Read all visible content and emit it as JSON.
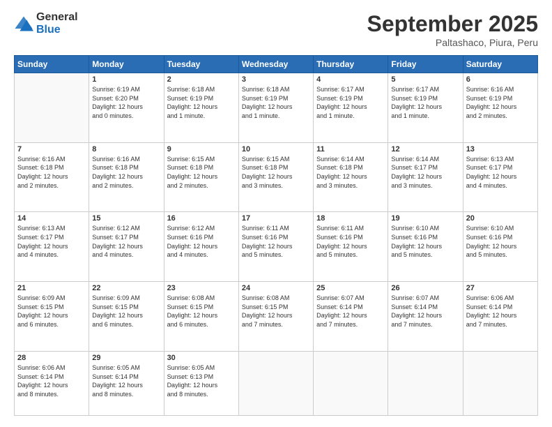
{
  "logo": {
    "general": "General",
    "blue": "Blue"
  },
  "header": {
    "title": "September 2025",
    "subtitle": "Paltashaco, Piura, Peru"
  },
  "days_of_week": [
    "Sunday",
    "Monday",
    "Tuesday",
    "Wednesday",
    "Thursday",
    "Friday",
    "Saturday"
  ],
  "weeks": [
    [
      {
        "day": "",
        "info": ""
      },
      {
        "day": "1",
        "info": "Sunrise: 6:19 AM\nSunset: 6:20 PM\nDaylight: 12 hours\nand 0 minutes."
      },
      {
        "day": "2",
        "info": "Sunrise: 6:18 AM\nSunset: 6:19 PM\nDaylight: 12 hours\nand 1 minute."
      },
      {
        "day": "3",
        "info": "Sunrise: 6:18 AM\nSunset: 6:19 PM\nDaylight: 12 hours\nand 1 minute."
      },
      {
        "day": "4",
        "info": "Sunrise: 6:17 AM\nSunset: 6:19 PM\nDaylight: 12 hours\nand 1 minute."
      },
      {
        "day": "5",
        "info": "Sunrise: 6:17 AM\nSunset: 6:19 PM\nDaylight: 12 hours\nand 1 minute."
      },
      {
        "day": "6",
        "info": "Sunrise: 6:16 AM\nSunset: 6:19 PM\nDaylight: 12 hours\nand 2 minutes."
      }
    ],
    [
      {
        "day": "7",
        "info": "Sunrise: 6:16 AM\nSunset: 6:18 PM\nDaylight: 12 hours\nand 2 minutes."
      },
      {
        "day": "8",
        "info": "Sunrise: 6:16 AM\nSunset: 6:18 PM\nDaylight: 12 hours\nand 2 minutes."
      },
      {
        "day": "9",
        "info": "Sunrise: 6:15 AM\nSunset: 6:18 PM\nDaylight: 12 hours\nand 2 minutes."
      },
      {
        "day": "10",
        "info": "Sunrise: 6:15 AM\nSunset: 6:18 PM\nDaylight: 12 hours\nand 3 minutes."
      },
      {
        "day": "11",
        "info": "Sunrise: 6:14 AM\nSunset: 6:18 PM\nDaylight: 12 hours\nand 3 minutes."
      },
      {
        "day": "12",
        "info": "Sunrise: 6:14 AM\nSunset: 6:17 PM\nDaylight: 12 hours\nand 3 minutes."
      },
      {
        "day": "13",
        "info": "Sunrise: 6:13 AM\nSunset: 6:17 PM\nDaylight: 12 hours\nand 4 minutes."
      }
    ],
    [
      {
        "day": "14",
        "info": "Sunrise: 6:13 AM\nSunset: 6:17 PM\nDaylight: 12 hours\nand 4 minutes."
      },
      {
        "day": "15",
        "info": "Sunrise: 6:12 AM\nSunset: 6:17 PM\nDaylight: 12 hours\nand 4 minutes."
      },
      {
        "day": "16",
        "info": "Sunrise: 6:12 AM\nSunset: 6:16 PM\nDaylight: 12 hours\nand 4 minutes."
      },
      {
        "day": "17",
        "info": "Sunrise: 6:11 AM\nSunset: 6:16 PM\nDaylight: 12 hours\nand 5 minutes."
      },
      {
        "day": "18",
        "info": "Sunrise: 6:11 AM\nSunset: 6:16 PM\nDaylight: 12 hours\nand 5 minutes."
      },
      {
        "day": "19",
        "info": "Sunrise: 6:10 AM\nSunset: 6:16 PM\nDaylight: 12 hours\nand 5 minutes."
      },
      {
        "day": "20",
        "info": "Sunrise: 6:10 AM\nSunset: 6:16 PM\nDaylight: 12 hours\nand 5 minutes."
      }
    ],
    [
      {
        "day": "21",
        "info": "Sunrise: 6:09 AM\nSunset: 6:15 PM\nDaylight: 12 hours\nand 6 minutes."
      },
      {
        "day": "22",
        "info": "Sunrise: 6:09 AM\nSunset: 6:15 PM\nDaylight: 12 hours\nand 6 minutes."
      },
      {
        "day": "23",
        "info": "Sunrise: 6:08 AM\nSunset: 6:15 PM\nDaylight: 12 hours\nand 6 minutes."
      },
      {
        "day": "24",
        "info": "Sunrise: 6:08 AM\nSunset: 6:15 PM\nDaylight: 12 hours\nand 7 minutes."
      },
      {
        "day": "25",
        "info": "Sunrise: 6:07 AM\nSunset: 6:14 PM\nDaylight: 12 hours\nand 7 minutes."
      },
      {
        "day": "26",
        "info": "Sunrise: 6:07 AM\nSunset: 6:14 PM\nDaylight: 12 hours\nand 7 minutes."
      },
      {
        "day": "27",
        "info": "Sunrise: 6:06 AM\nSunset: 6:14 PM\nDaylight: 12 hours\nand 7 minutes."
      }
    ],
    [
      {
        "day": "28",
        "info": "Sunrise: 6:06 AM\nSunset: 6:14 PM\nDaylight: 12 hours\nand 8 minutes."
      },
      {
        "day": "29",
        "info": "Sunrise: 6:05 AM\nSunset: 6:14 PM\nDaylight: 12 hours\nand 8 minutes."
      },
      {
        "day": "30",
        "info": "Sunrise: 6:05 AM\nSunset: 6:13 PM\nDaylight: 12 hours\nand 8 minutes."
      },
      {
        "day": "",
        "info": ""
      },
      {
        "day": "",
        "info": ""
      },
      {
        "day": "",
        "info": ""
      },
      {
        "day": "",
        "info": ""
      }
    ]
  ]
}
